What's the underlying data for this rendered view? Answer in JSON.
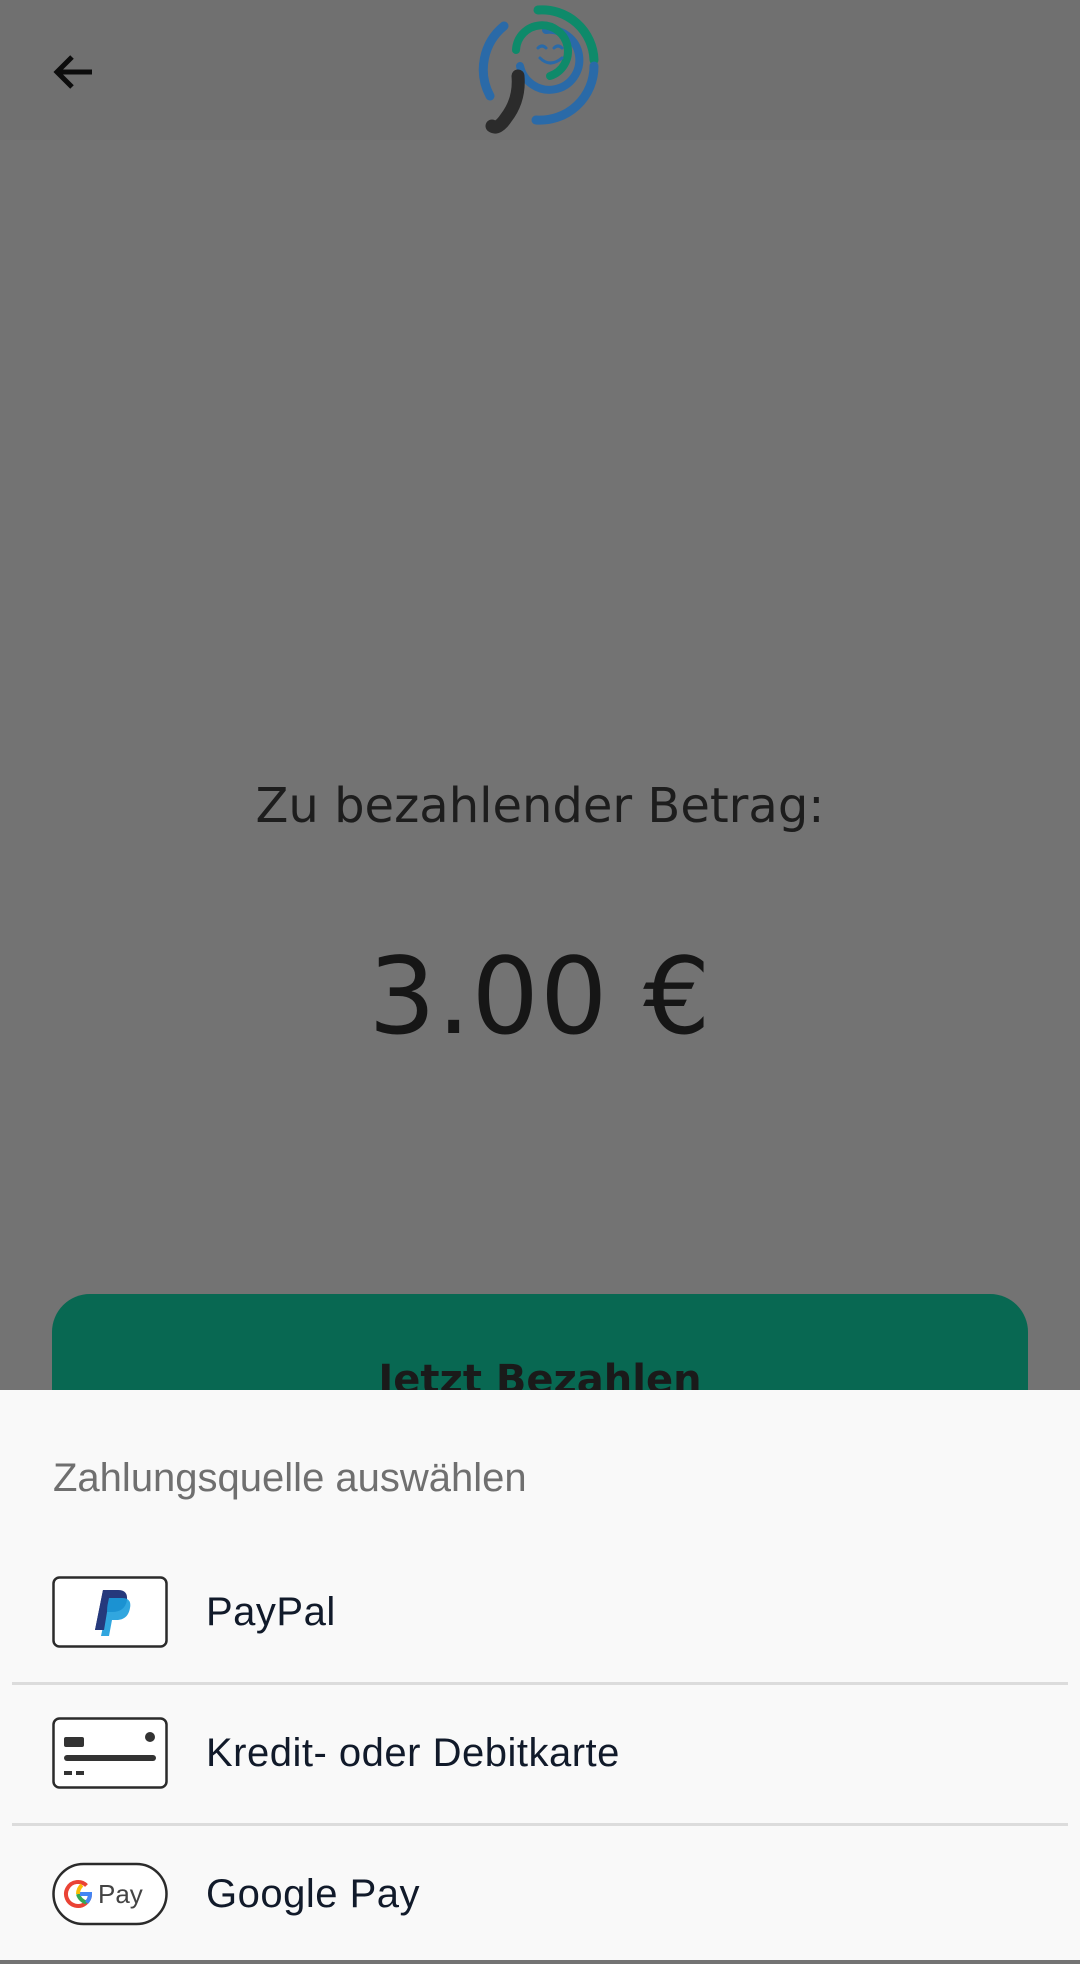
{
  "header": {
    "back_icon": "arrow-back-icon",
    "logo_icon": "app-logo"
  },
  "payment": {
    "amount_label": "Zu bezahlender Betrag:",
    "amount_value": "3.00 €",
    "pay_button_label": "Jetzt Bezahlen"
  },
  "sheet": {
    "title": "Zahlungsquelle auswählen",
    "options": [
      {
        "label": "PayPal",
        "icon": "paypal-icon"
      },
      {
        "label": "Kredit- oder Debitkarte",
        "icon": "credit-card-icon"
      },
      {
        "label": "Google Pay",
        "icon": "google-pay-icon"
      }
    ]
  },
  "colors": {
    "overlay_background": "#737373",
    "pay_button": "#086852",
    "sheet_background": "#f9f9f9",
    "logo_blue": "#2a6aa8",
    "logo_green": "#0e8a6a"
  }
}
